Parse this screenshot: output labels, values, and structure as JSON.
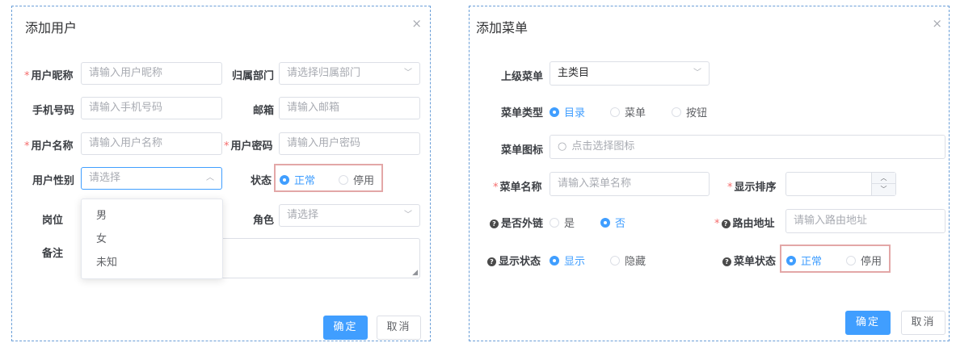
{
  "user_dialog": {
    "title": "添加用户",
    "close_icon": "×",
    "fields": {
      "nickname": {
        "label": "用户昵称",
        "placeholder": "请输入用户昵称"
      },
      "dept": {
        "label": "归属部门",
        "placeholder": "请选择归属部门"
      },
      "phone": {
        "label": "手机号码",
        "placeholder": "请输入手机号码"
      },
      "email": {
        "label": "邮箱",
        "placeholder": "请输入邮箱"
      },
      "username": {
        "label": "用户名称",
        "placeholder": "请输入用户名称"
      },
      "password": {
        "label": "用户密码",
        "placeholder": "请输入用户密码"
      },
      "gender": {
        "label": "用户性别",
        "placeholder": "请选择"
      },
      "status": {
        "label": "状态",
        "options": [
          "正常",
          "停用"
        ],
        "selected": "正常"
      },
      "post": {
        "label": "岗位"
      },
      "role": {
        "label": "角色",
        "placeholder": "请选择"
      },
      "remark": {
        "label": "备注"
      }
    },
    "gender_options": [
      "男",
      "女",
      "未知"
    ],
    "confirm_label": "确定",
    "cancel_label": "取消"
  },
  "menu_dialog": {
    "title": "添加菜单",
    "close_icon": "×",
    "fields": {
      "parent": {
        "label": "上级菜单",
        "value": "主类目"
      },
      "type": {
        "label": "菜单类型",
        "options": [
          "目录",
          "菜单",
          "按钮"
        ],
        "selected": "目录"
      },
      "icon": {
        "label": "菜单图标",
        "placeholder": "点击选择图标"
      },
      "name": {
        "label": "菜单名称",
        "placeholder": "请输入菜单名称"
      },
      "order": {
        "label": "显示排序"
      },
      "external": {
        "label": "是否外链",
        "options": [
          "是",
          "否"
        ],
        "selected": "否"
      },
      "route": {
        "label": "路由地址",
        "placeholder": "请输入路由地址"
      },
      "visible": {
        "label": "显示状态",
        "options": [
          "显示",
          "隐藏"
        ],
        "selected": "显示"
      },
      "status": {
        "label": "菜单状态",
        "options": [
          "正常",
          "停用"
        ],
        "selected": "正常"
      }
    },
    "confirm_label": "确定",
    "cancel_label": "取消"
  },
  "colors": {
    "primary": "#409eff",
    "required": "#f56c6c",
    "highlight": "#e3a7a7",
    "dialog_border": "#6b9fd8"
  },
  "icons": {
    "close": "close-icon",
    "chevron_down": "chevron-down-icon",
    "chevron_up": "chevron-up-icon",
    "search": "search-icon",
    "help": "question-circle-icon",
    "resize": "resize-handle-icon"
  }
}
